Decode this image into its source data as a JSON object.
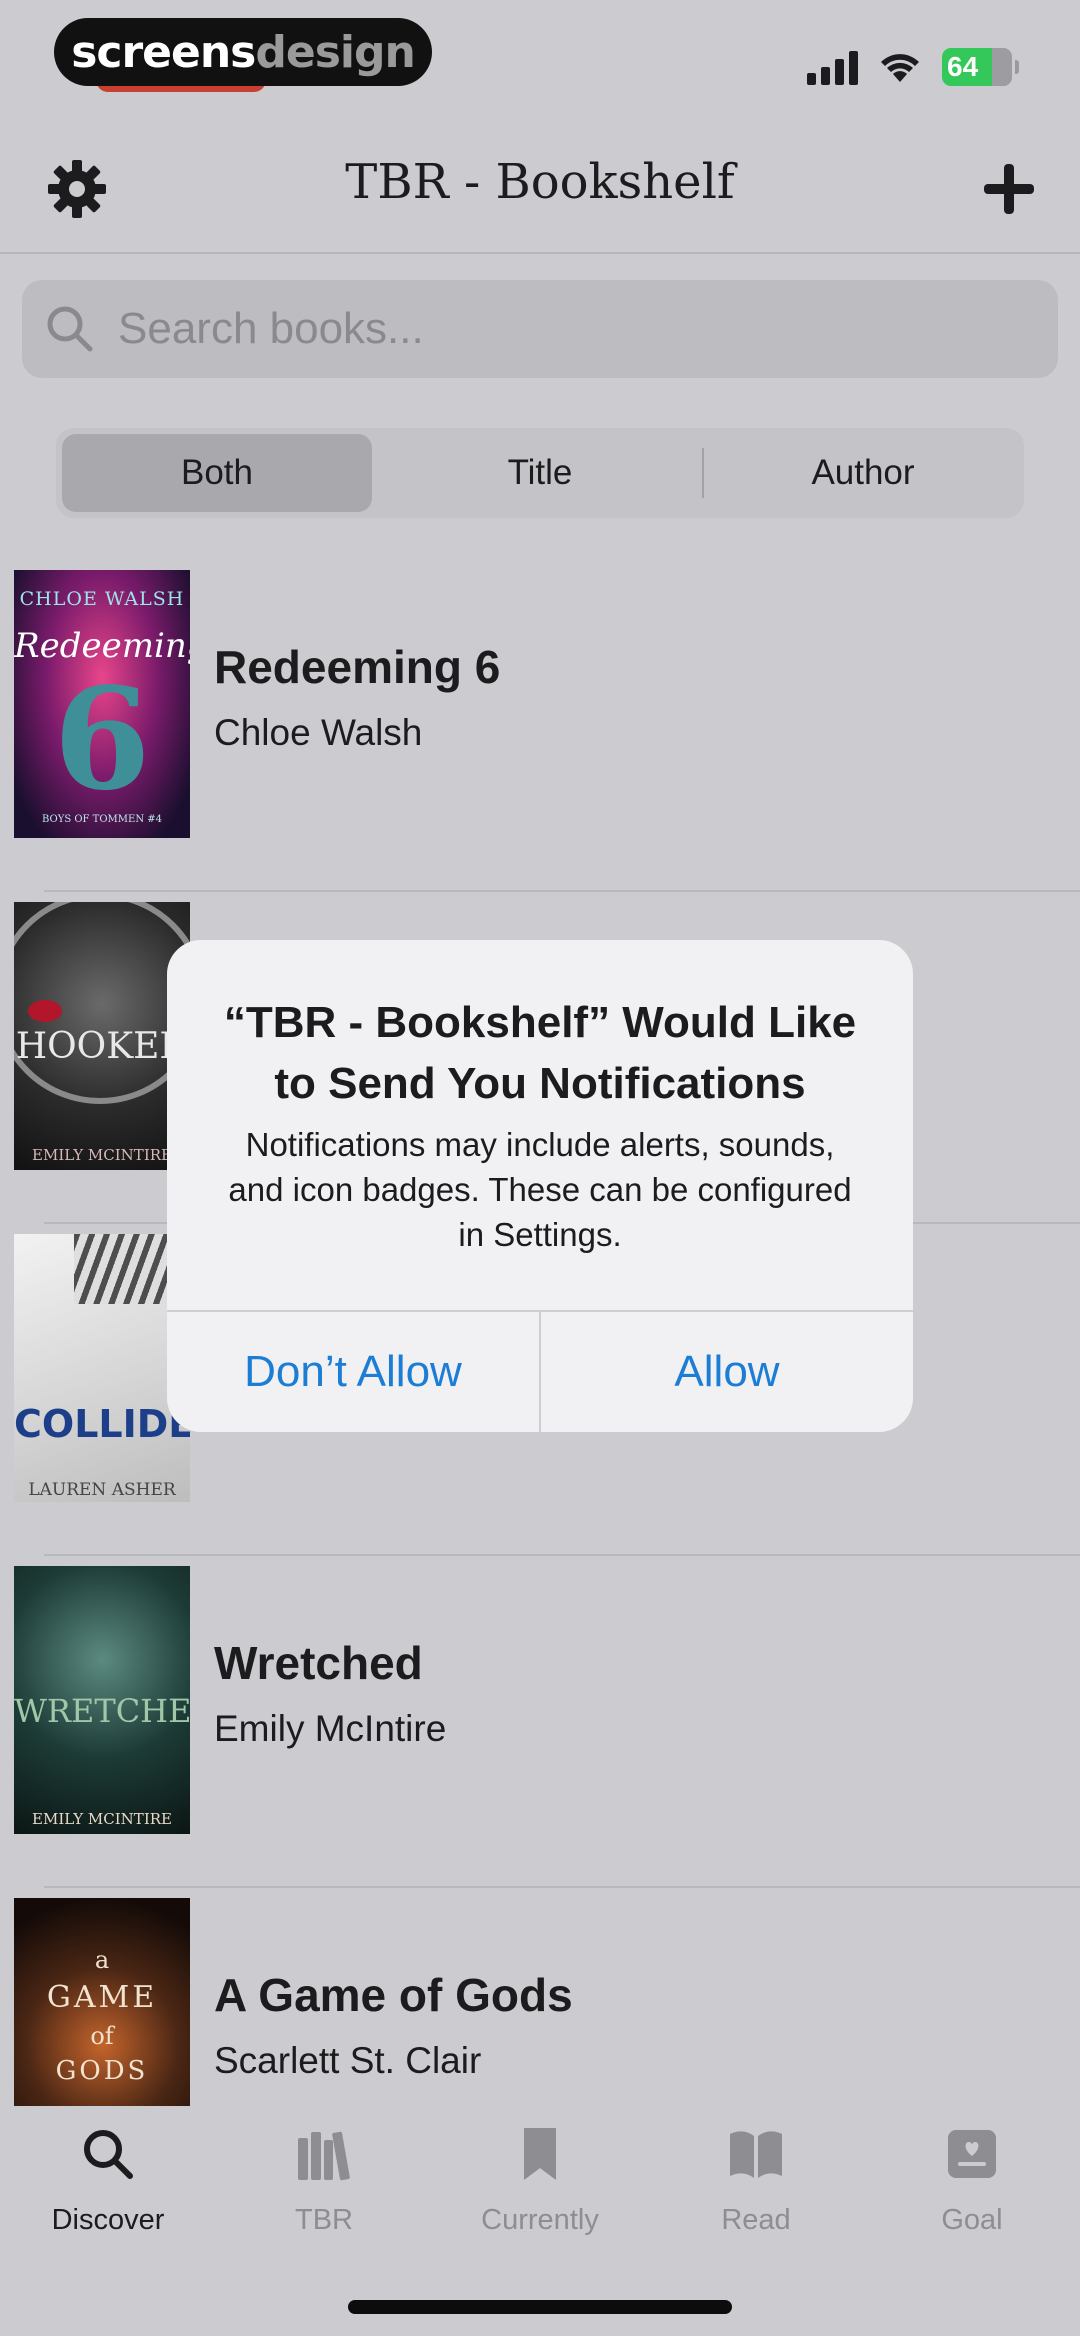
{
  "status_bar": {
    "brand_a": "screens",
    "brand_b": "design",
    "battery": "64"
  },
  "nav": {
    "title": "TBR - Bookshelf"
  },
  "search": {
    "placeholder": "Search books..."
  },
  "segments": [
    "Both",
    "Title",
    "Author"
  ],
  "books": [
    {
      "title": "Redeeming 6",
      "author": "Chloe Walsh",
      "cover_text": [
        "CHLOE WALSH",
        "Redeeming",
        "6",
        "BOYS OF TOMMEN #4"
      ]
    },
    {
      "title": "",
      "author": "",
      "cover_text": [
        "HOOKED",
        "EMILY MCINTIRE"
      ]
    },
    {
      "title": "",
      "author": "",
      "cover_text": [
        "COLLIDED",
        "LAUREN ASHER"
      ]
    },
    {
      "title": "Wretched",
      "author": "Emily McIntire",
      "cover_text": [
        "WRETCHED",
        "EMILY MCINTIRE"
      ]
    },
    {
      "title": "A Game of Gods",
      "author": "Scarlett St. Clair",
      "cover_text": [
        "a",
        "GAME",
        "of",
        "GODS"
      ]
    }
  ],
  "alert": {
    "title": "“TBR - Bookshelf” Would Like to Send You Notifications",
    "message": "Notifications may include alerts, sounds, and icon badges. These can be configured in Settings.",
    "deny": "Don’t Allow",
    "allow": "Allow"
  },
  "tabs": [
    {
      "label": "Discover",
      "icon": "search-icon",
      "active": true
    },
    {
      "label": "TBR",
      "icon": "books-icon",
      "active": false
    },
    {
      "label": "Currently",
      "icon": "bookmark-icon",
      "active": false
    },
    {
      "label": "Read",
      "icon": "open-book-icon",
      "active": false
    },
    {
      "label": "Goal",
      "icon": "goal-icon",
      "active": false
    }
  ],
  "colors": {
    "accent": "#1b7dd4",
    "battery": "#34c759",
    "background": "#cccbcf"
  }
}
